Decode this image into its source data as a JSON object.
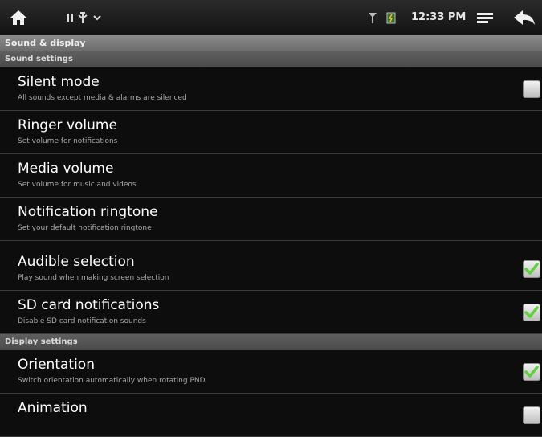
{
  "status_bar": {
    "time": "12:33 PM",
    "icons": [
      "home-icon",
      "notification-icons",
      "signal-icon",
      "battery-icon",
      "menu-icon",
      "back-icon"
    ]
  },
  "screen_title": "Sound & display",
  "sections": [
    {
      "label": "Sound settings"
    },
    {
      "label": "Display settings"
    }
  ],
  "settings": [
    {
      "title": "Silent mode",
      "summary": "All sounds except media & alarms are silenced",
      "checkbox": true,
      "checked": false
    },
    {
      "title": "Ringer volume",
      "summary": "Set volume for notifications",
      "checkbox": false
    },
    {
      "title": "Media volume",
      "summary": "Set volume for music and videos",
      "checkbox": false
    },
    {
      "title": "Notification ringtone",
      "summary": "Set your default notification ringtone",
      "checkbox": false
    },
    {
      "title": "Audible selection",
      "summary": "Play sound when making screen selection",
      "checkbox": true,
      "checked": true
    },
    {
      "title": "SD card notifications",
      "summary": "Disable SD card notification sounds",
      "checkbox": true,
      "checked": true
    },
    {
      "title": "Orientation",
      "summary": "Switch orientation automatically when rotating PND",
      "checkbox": true,
      "checked": true
    },
    {
      "title": "Animation",
      "summary": "",
      "checkbox": true,
      "checked": false
    }
  ],
  "colors": {
    "check": "#5fd13c",
    "background": "#0d0d0d",
    "header": "#8b8b8b"
  }
}
